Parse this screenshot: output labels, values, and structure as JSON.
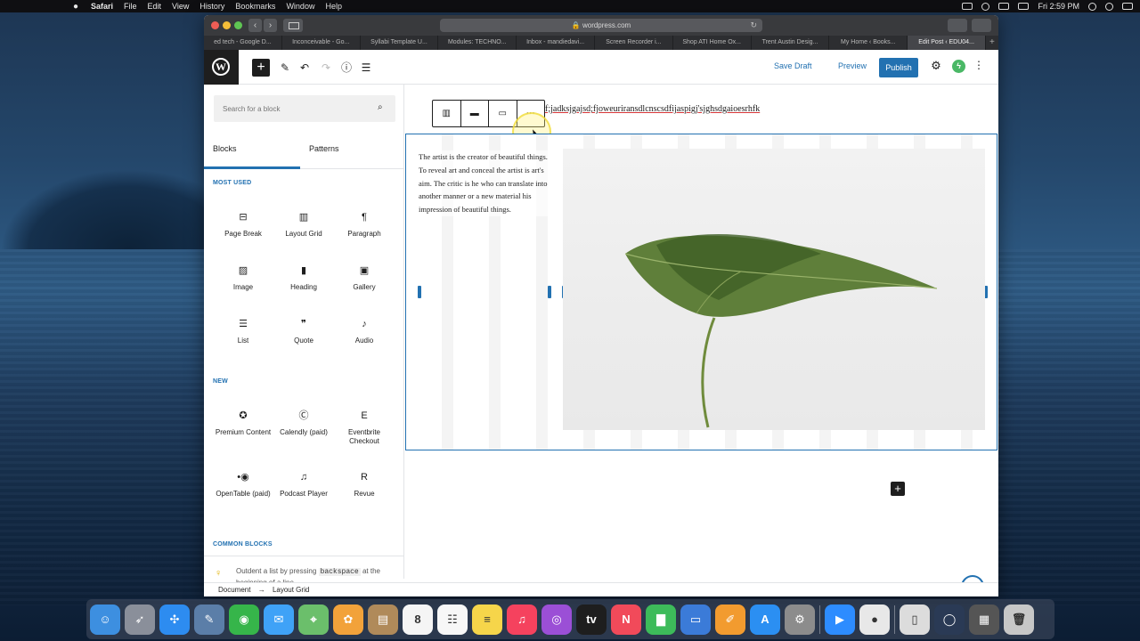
{
  "menubar": {
    "apple_icon": "apple-icon",
    "items": [
      "Safari",
      "File",
      "Edit",
      "View",
      "History",
      "Bookmarks",
      "Window",
      "Help"
    ],
    "clock": "Fri 2:59 PM"
  },
  "browser": {
    "url": "wordpress.com",
    "tabs": [
      "ed tech - Google D...",
      "Inconceivable - Go...",
      "Syllabi Template U...",
      "Modules: TECHNO...",
      "Inbox - mandiedavi...",
      "Screen Recorder i...",
      "Shop ATI Home Ox...",
      "Trent Austin Desig...",
      "My Home ‹ Books...",
      "Edit Post ‹ EDU04..."
    ],
    "active_tab_index": 9,
    "new_tab_symbol": "+"
  },
  "wp_toolbar": {
    "logo_letter": "W",
    "add_symbol": "+",
    "save_draft": "Save Draft",
    "preview": "Preview",
    "publish": "Publish",
    "accent": "#2271b1"
  },
  "inserter": {
    "search_placeholder": "Search for a block",
    "tabs": {
      "blocks": "Blocks",
      "patterns": "Patterns"
    },
    "most_used_title": "MOST USED",
    "most_used": [
      {
        "label": "Page Break",
        "icon": "page-break-icon",
        "glyph": "⊟"
      },
      {
        "label": "Layout Grid",
        "icon": "layout-grid-icon",
        "glyph": "▥"
      },
      {
        "label": "Paragraph",
        "icon": "paragraph-icon",
        "glyph": "¶"
      },
      {
        "label": "Image",
        "icon": "image-icon",
        "glyph": "▨"
      },
      {
        "label": "Heading",
        "icon": "heading-icon",
        "glyph": "▮"
      },
      {
        "label": "Gallery",
        "icon": "gallery-icon",
        "glyph": "▣"
      },
      {
        "label": "List",
        "icon": "list-icon",
        "glyph": "☰"
      },
      {
        "label": "Quote",
        "icon": "quote-icon",
        "glyph": "❞"
      },
      {
        "label": "Audio",
        "icon": "audio-icon",
        "glyph": "♪"
      }
    ],
    "new_title": "NEW",
    "new_blocks": [
      {
        "label": "Premium Content",
        "icon": "premium-content-icon",
        "glyph": "✪"
      },
      {
        "label": "Calendly (paid)",
        "icon": "calendly-icon",
        "glyph": "Ⓒ"
      },
      {
        "label": "Eventbrite Checkout",
        "icon": "eventbrite-icon",
        "glyph": "E"
      },
      {
        "label": "OpenTable (paid)",
        "icon": "opentable-icon",
        "glyph": "•◉"
      },
      {
        "label": "Podcast Player",
        "icon": "podcast-player-icon",
        "glyph": "♫"
      },
      {
        "label": "Revue",
        "icon": "revue-icon",
        "glyph": "R"
      }
    ],
    "common_title": "COMMON BLOCKS",
    "tip_before": "Outdent a list by pressing",
    "tip_code": "backspace",
    "tip_after": "at the beginning of a line."
  },
  "breadcrumb": {
    "root": "Document",
    "arrow": "→",
    "current": "Layout Grid"
  },
  "editor": {
    "heading_text": "f;jadksjgajsd;fjoweuriransdlcnscsdfijaspigj'sjghsdgaioesrhfk",
    "paragraph": "The artist is the creator of beautiful things. To reveal art and conceal the artist is art's aim. The critic is he who can translate into another manner or a new material his impression of beautiful things.",
    "more_symbol": "⋯",
    "add_symbol": "+",
    "help_symbol": "?"
  },
  "dock": {
    "apps": [
      {
        "icon": "finder-icon",
        "color": "#3d8fe0",
        "glyph": "☺"
      },
      {
        "icon": "launchpad-icon",
        "color": "#8a8f9a",
        "glyph": "➶"
      },
      {
        "icon": "safari-icon",
        "color": "#2d8cf0",
        "glyph": "✣"
      },
      {
        "icon": "preview-icon",
        "color": "#5b7ea8",
        "glyph": "✎"
      },
      {
        "icon": "facetime-icon",
        "color": "#36b54a",
        "glyph": "◉"
      },
      {
        "icon": "messages-icon",
        "color": "#3fa2f7",
        "glyph": "✉"
      },
      {
        "icon": "maps-icon",
        "color": "#6bbf6b",
        "glyph": "⌖"
      },
      {
        "icon": "photos-icon",
        "color": "#f2a23a",
        "glyph": "✿"
      },
      {
        "icon": "notes-book-icon",
        "color": "#b08a5a",
        "glyph": "▤"
      },
      {
        "icon": "calendar-icon",
        "color": "#f5f5f5",
        "glyph": "8"
      },
      {
        "icon": "reminders-icon",
        "color": "#f7f7f7",
        "glyph": "☷"
      },
      {
        "icon": "notes-icon",
        "color": "#f6d54a",
        "glyph": "≡"
      },
      {
        "icon": "music-icon",
        "color": "#f5425e",
        "glyph": "♫"
      },
      {
        "icon": "podcasts-icon",
        "color": "#9b4fd6",
        "glyph": "◎"
      },
      {
        "icon": "tv-icon",
        "color": "#1e1e1e",
        "glyph": "tv"
      },
      {
        "icon": "news-icon",
        "color": "#f14a5a",
        "glyph": "N"
      },
      {
        "icon": "numbers-icon",
        "color": "#3dbb5a",
        "glyph": "▇"
      },
      {
        "icon": "keynote-icon",
        "color": "#3b7bd8",
        "glyph": "▭"
      },
      {
        "icon": "pages-icon",
        "color": "#f29b2f",
        "glyph": "✐"
      },
      {
        "icon": "app-store-icon",
        "color": "#2b8ff2",
        "glyph": "A"
      },
      {
        "icon": "system-preferences-icon",
        "color": "#8c8c8c",
        "glyph": "⚙"
      },
      {
        "icon": "zoom-icon",
        "color": "#2d8cff",
        "glyph": "▶"
      },
      {
        "icon": "screen-recorder-icon",
        "color": "#e8e8e8",
        "glyph": "●"
      },
      {
        "icon": "document-icon",
        "color": "#dcdcdc",
        "glyph": "▯"
      },
      {
        "icon": "siri-icon",
        "color": "#2a3a55",
        "glyph": "◯"
      },
      {
        "icon": "recent-folder-icon",
        "color": "#555",
        "glyph": "▦"
      },
      {
        "icon": "trash-icon",
        "color": "#c7c7c7",
        "glyph": "🗑"
      }
    ]
  }
}
